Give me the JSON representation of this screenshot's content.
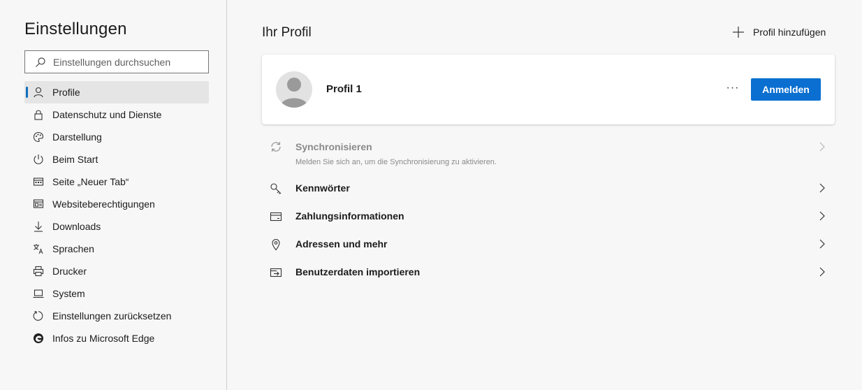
{
  "sidebar": {
    "title": "Einstellungen",
    "search": {
      "placeholder": "Einstellungen durchsuchen",
      "icon": "search-icon"
    },
    "items": [
      {
        "label": "Profile",
        "icon": "person-icon",
        "active": true
      },
      {
        "label": "Datenschutz und Dienste",
        "icon": "lock-icon"
      },
      {
        "label": "Darstellung",
        "icon": "palette-icon"
      },
      {
        "label": "Beim Start",
        "icon": "power-icon"
      },
      {
        "label": "Seite „Neuer Tab“",
        "icon": "new-tab-icon"
      },
      {
        "label": "Websiteberechtigungen",
        "icon": "site-permissions-icon"
      },
      {
        "label": "Downloads",
        "icon": "download-icon"
      },
      {
        "label": "Sprachen",
        "icon": "language-icon"
      },
      {
        "label": "Drucker",
        "icon": "printer-icon"
      },
      {
        "label": "System",
        "icon": "laptop-icon"
      },
      {
        "label": "Einstellungen zurücksetzen",
        "icon": "reset-icon"
      },
      {
        "label": "Infos zu Microsoft Edge",
        "icon": "edge-logo-icon"
      }
    ]
  },
  "main": {
    "title": "Ihr Profil",
    "add_profile_label": "Profil hinzufügen",
    "profile": {
      "name": "Profil 1",
      "more_label": "···",
      "signin_label": "Anmelden"
    },
    "rows": [
      {
        "label": "Synchronisieren",
        "description": "Melden Sie sich an, um die Synchronisierung zu aktivieren.",
        "icon": "sync-icon",
        "disabled": true
      },
      {
        "label": "Kennwörter",
        "icon": "key-icon"
      },
      {
        "label": "Zahlungsinformationen",
        "icon": "card-icon"
      },
      {
        "label": "Adressen und mehr",
        "icon": "location-pin-icon"
      },
      {
        "label": "Benutzerdaten importieren",
        "icon": "import-icon"
      }
    ]
  },
  "colors": {
    "accent": "#0a6fd1",
    "background": "#f7f7f7",
    "active_nav": "#e5e5e5",
    "disabled_text": "#8a8a8a"
  }
}
